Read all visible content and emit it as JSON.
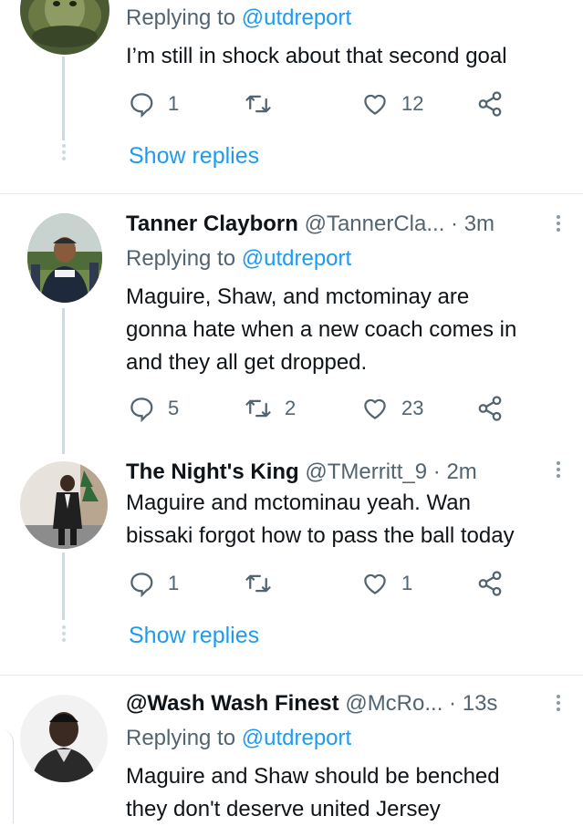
{
  "tweets": [
    {
      "replying_prefix": "Replying to",
      "replying_to": "@utdreport",
      "text": "I’m still in shock about that second goal",
      "reply_count": "1",
      "retweet_count": "",
      "like_count": "12",
      "show_replies": "Show replies",
      "avatar_icon": "tortoise-avatar"
    },
    {
      "name": "Tanner Clayborn",
      "handle": "@TannerCla...",
      "sep": "·",
      "time": "3m",
      "replying_prefix": "Replying to",
      "replying_to": "@utdreport",
      "text": "Maguire, Shaw, and mctominay are\ngonna hate when a new coach comes in\nand they all get dropped.",
      "reply_count": "5",
      "retweet_count": "2",
      "like_count": "23",
      "avatar_icon": "man-in-stadium-avatar"
    },
    {
      "name": "The Night's King",
      "handle": "@TMerritt_9",
      "sep": "·",
      "time": "2m",
      "text": "Maguire and mctominau yeah. Wan\nbissaki forgot how to pass the ball today",
      "reply_count": "1",
      "retweet_count": "",
      "like_count": "1",
      "show_replies": "Show replies",
      "avatar_icon": "man-in-suit-avatar"
    },
    {
      "name": "@Wash Wash Finest",
      "handle": "@McRo...",
      "sep": "·",
      "time": "13s",
      "replying_prefix": "Replying to",
      "replying_to": "@utdreport",
      "text": "Maguire and Shaw should be benched\nthey don't deserve united Jersey",
      "avatar_icon": "man-headshot-avatar"
    }
  ],
  "colors": {
    "accent": "#1d9bf0",
    "secondary_text": "#536471",
    "thread_line": "#cfd9de"
  },
  "icons": [
    "reply-icon",
    "retweet-icon",
    "like-icon",
    "share-icon",
    "more-icon"
  ]
}
